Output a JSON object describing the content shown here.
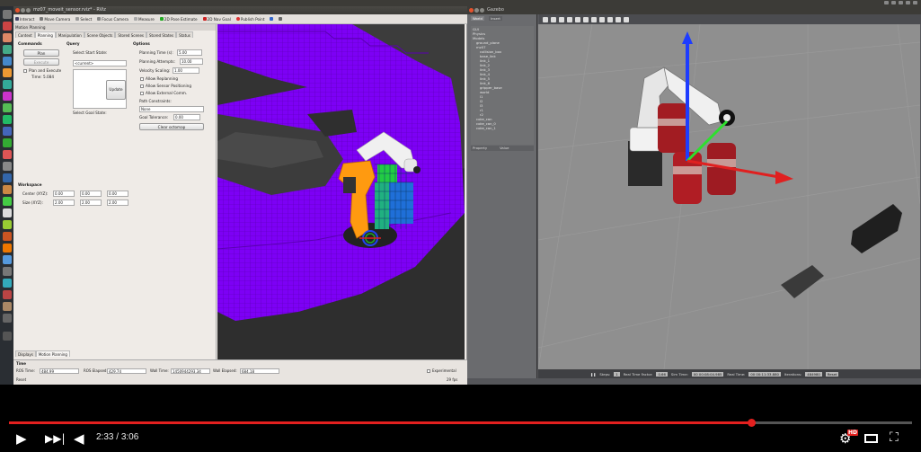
{
  "rviz": {
    "title": "mz07_moveit_sensor.rviz* - RViz",
    "toolbar": [
      "Interact",
      "Move Camera",
      "Select",
      "Focus Camera",
      "Measure",
      "2D Pose Estimate",
      "2D Nav Goal",
      "Publish Point"
    ],
    "panel_title": "Motion Planning",
    "tabs": [
      "Context",
      "Planning",
      "Manipulation",
      "Scene Objects",
      "Stored Scenes",
      "Stored States",
      "Status"
    ],
    "commands_heading": "Commands",
    "plan_button": "Plan",
    "execute_button": "Execute",
    "plan_execute_label": "Plan and Execute",
    "timer_label": "Time: 5.084",
    "query_heading": "Query",
    "start_state_label": "Select Start State:",
    "start_state_value": "<current>",
    "update_button": "Update",
    "goal_state_label": "Select Goal State:",
    "options_heading": "Options",
    "planning_time_label": "Planning Time (s):",
    "planning_time_value": "5.00",
    "planning_attempts_label": "Planning Attempts:",
    "planning_attempts_value": "10.00",
    "velocity_scaling_label": "Velocity Scaling:",
    "velocity_scaling_value": "1.00",
    "allow_replanning": "Allow Replanning",
    "allow_sensor_positioning": "Allow Sensor Positioning",
    "allow_external_comm": "Allow External Comm.",
    "path_constraints_label": "Path Constraints:",
    "path_constraints_value": "None",
    "goal_tolerance_label": "Goal Tolerance:",
    "goal_tolerance_value": "0.00",
    "clear_octomap_button": "Clear octomap",
    "workspace_heading": "Workspace",
    "center_label": "Center (XYZ):",
    "center_values": [
      "0.00",
      "0.00",
      "0.00"
    ],
    "size_label": "Size (XYZ):",
    "size_values": [
      "2.00",
      "2.00",
      "2.00"
    ],
    "bottom_tabs": [
      "Displays",
      "Motion Planning"
    ],
    "time_panel": {
      "title": "Time",
      "ros_time_label": "ROS Time:",
      "ros_time_value": "484.99",
      "ros_elapsed_label": "ROS Elapsed:",
      "ros_elapsed_value": "429.74",
      "wall_time_label": "Wall Time:",
      "wall_time_value": "1450944293.34",
      "wall_elapsed_label": "Wall Elapsed:",
      "wall_elapsed_value": "684.18",
      "experimental_label": "Experimental",
      "reset_button": "Reset",
      "fps": "29 fps"
    }
  },
  "gazebo": {
    "title": "Gazebo",
    "left_tabs": [
      "World",
      "Insert"
    ],
    "tree": [
      "GUI",
      "Physics",
      "Models",
      "ground_plane",
      "mz07",
      "collision_box",
      "base_link",
      "link_1",
      "link_2",
      "link_3",
      "link_4",
      "link_5",
      "link_6",
      "gripper_base",
      "world",
      "l1",
      "l2",
      "l3",
      "r1",
      "r2",
      "coke_can",
      "coke_can_0",
      "coke_can_1"
    ],
    "props_headers": [
      "Property",
      "Value"
    ],
    "status": {
      "steps_label": "Steps:",
      "steps_value": "1",
      "real_time_factor_label": "Real Time Factor:",
      "real_time_factor_value": "0.66",
      "sim_time_label": "Sim Time:",
      "sim_time_value": "00 00:08:04.985",
      "real_time_label": "Real Time:",
      "real_time_value": "00 00:11:33.880",
      "iterations_label": "Iterations:",
      "iterations_value": "484980",
      "reset_button": "Reset"
    }
  },
  "player": {
    "current_time": "2:33",
    "duration": "3:06",
    "progress": 0.822,
    "buffered": 0.82,
    "hd_badge": "HD"
  },
  "colors": {
    "octomap": "#7d00f5",
    "progress_red": "#e4201f",
    "robot_orange": "#ff9a10"
  }
}
